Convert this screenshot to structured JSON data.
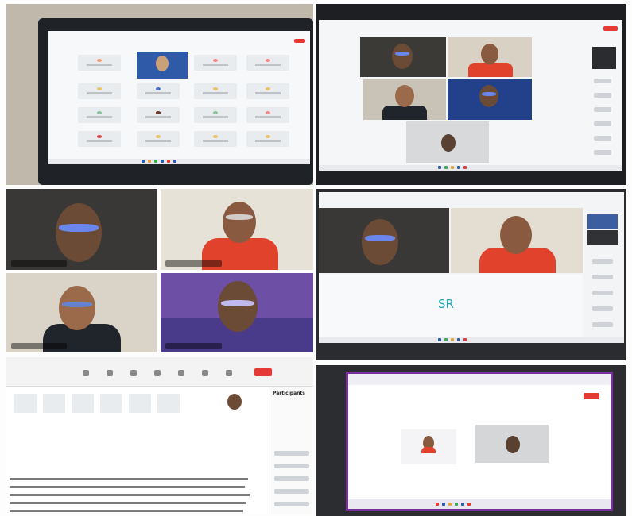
{
  "panels": {
    "middle_right": {
      "avatar_initials": "SR"
    },
    "bottom_left": {
      "sidebar_title": "Participants"
    }
  },
  "colors": {
    "accent_red": "#e53935",
    "meeting_blue": "#2f5aa8",
    "purple_bg": "#6e4fa6",
    "laptop_bezel": "#1f2226"
  }
}
